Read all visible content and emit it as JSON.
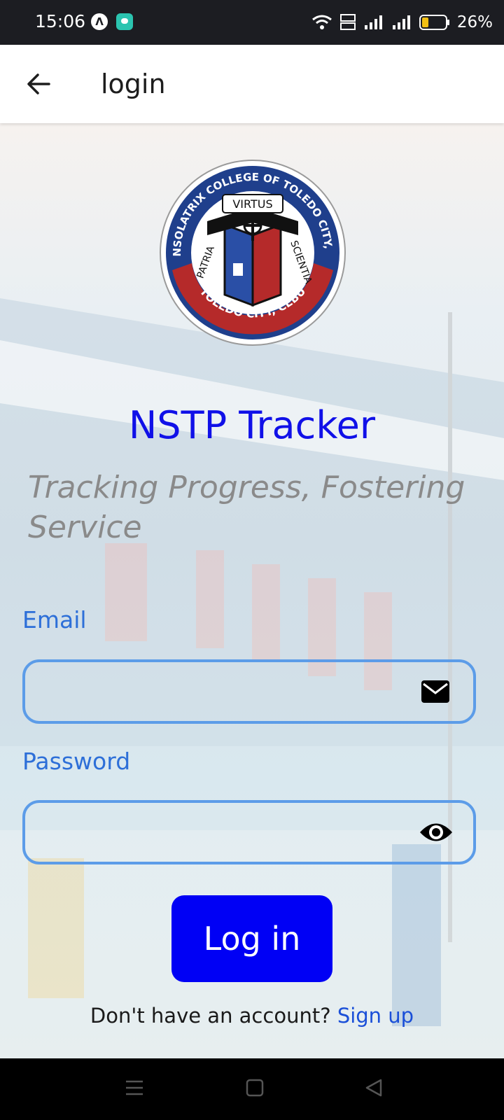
{
  "status_bar": {
    "time": "15:06",
    "battery": "26%",
    "icons": [
      "app-icon-a",
      "app-icon-chat",
      "wifi-icon",
      "volte-icon",
      "signal-icon",
      "signal-icon-2",
      "battery-icon"
    ]
  },
  "app_bar": {
    "title": "login",
    "back_icon": "back-arrow-icon"
  },
  "main": {
    "seal": {
      "top_text": "CONSOLATRIX COLLEGE OF TOLEDO CITY, INC",
      "bottom_text": "TOLEDO CITY, CEBU",
      "motto_top": "VIRTUS",
      "motto_left": "PATRIA",
      "motto_right": "SCIENTIA"
    },
    "title": "NSTP Tracker",
    "tagline": "Tracking Progress, Fostering Service",
    "email": {
      "label": "Email",
      "value": "",
      "placeholder": "",
      "icon": "envelope-icon"
    },
    "password": {
      "label": "Password",
      "value": "",
      "placeholder": "",
      "icon": "eye-icon"
    },
    "login_button": "Log in",
    "signup_prompt": "Don't have an account?",
    "signup_link": "Sign up"
  },
  "colors": {
    "title": "#1010e8",
    "button": "#0000f5",
    "field_border": "#5c9ce8",
    "label": "#2d6fd8"
  },
  "nav_bar": {
    "icons": [
      "menu-icon",
      "home-square-icon",
      "back-triangle-icon"
    ]
  }
}
